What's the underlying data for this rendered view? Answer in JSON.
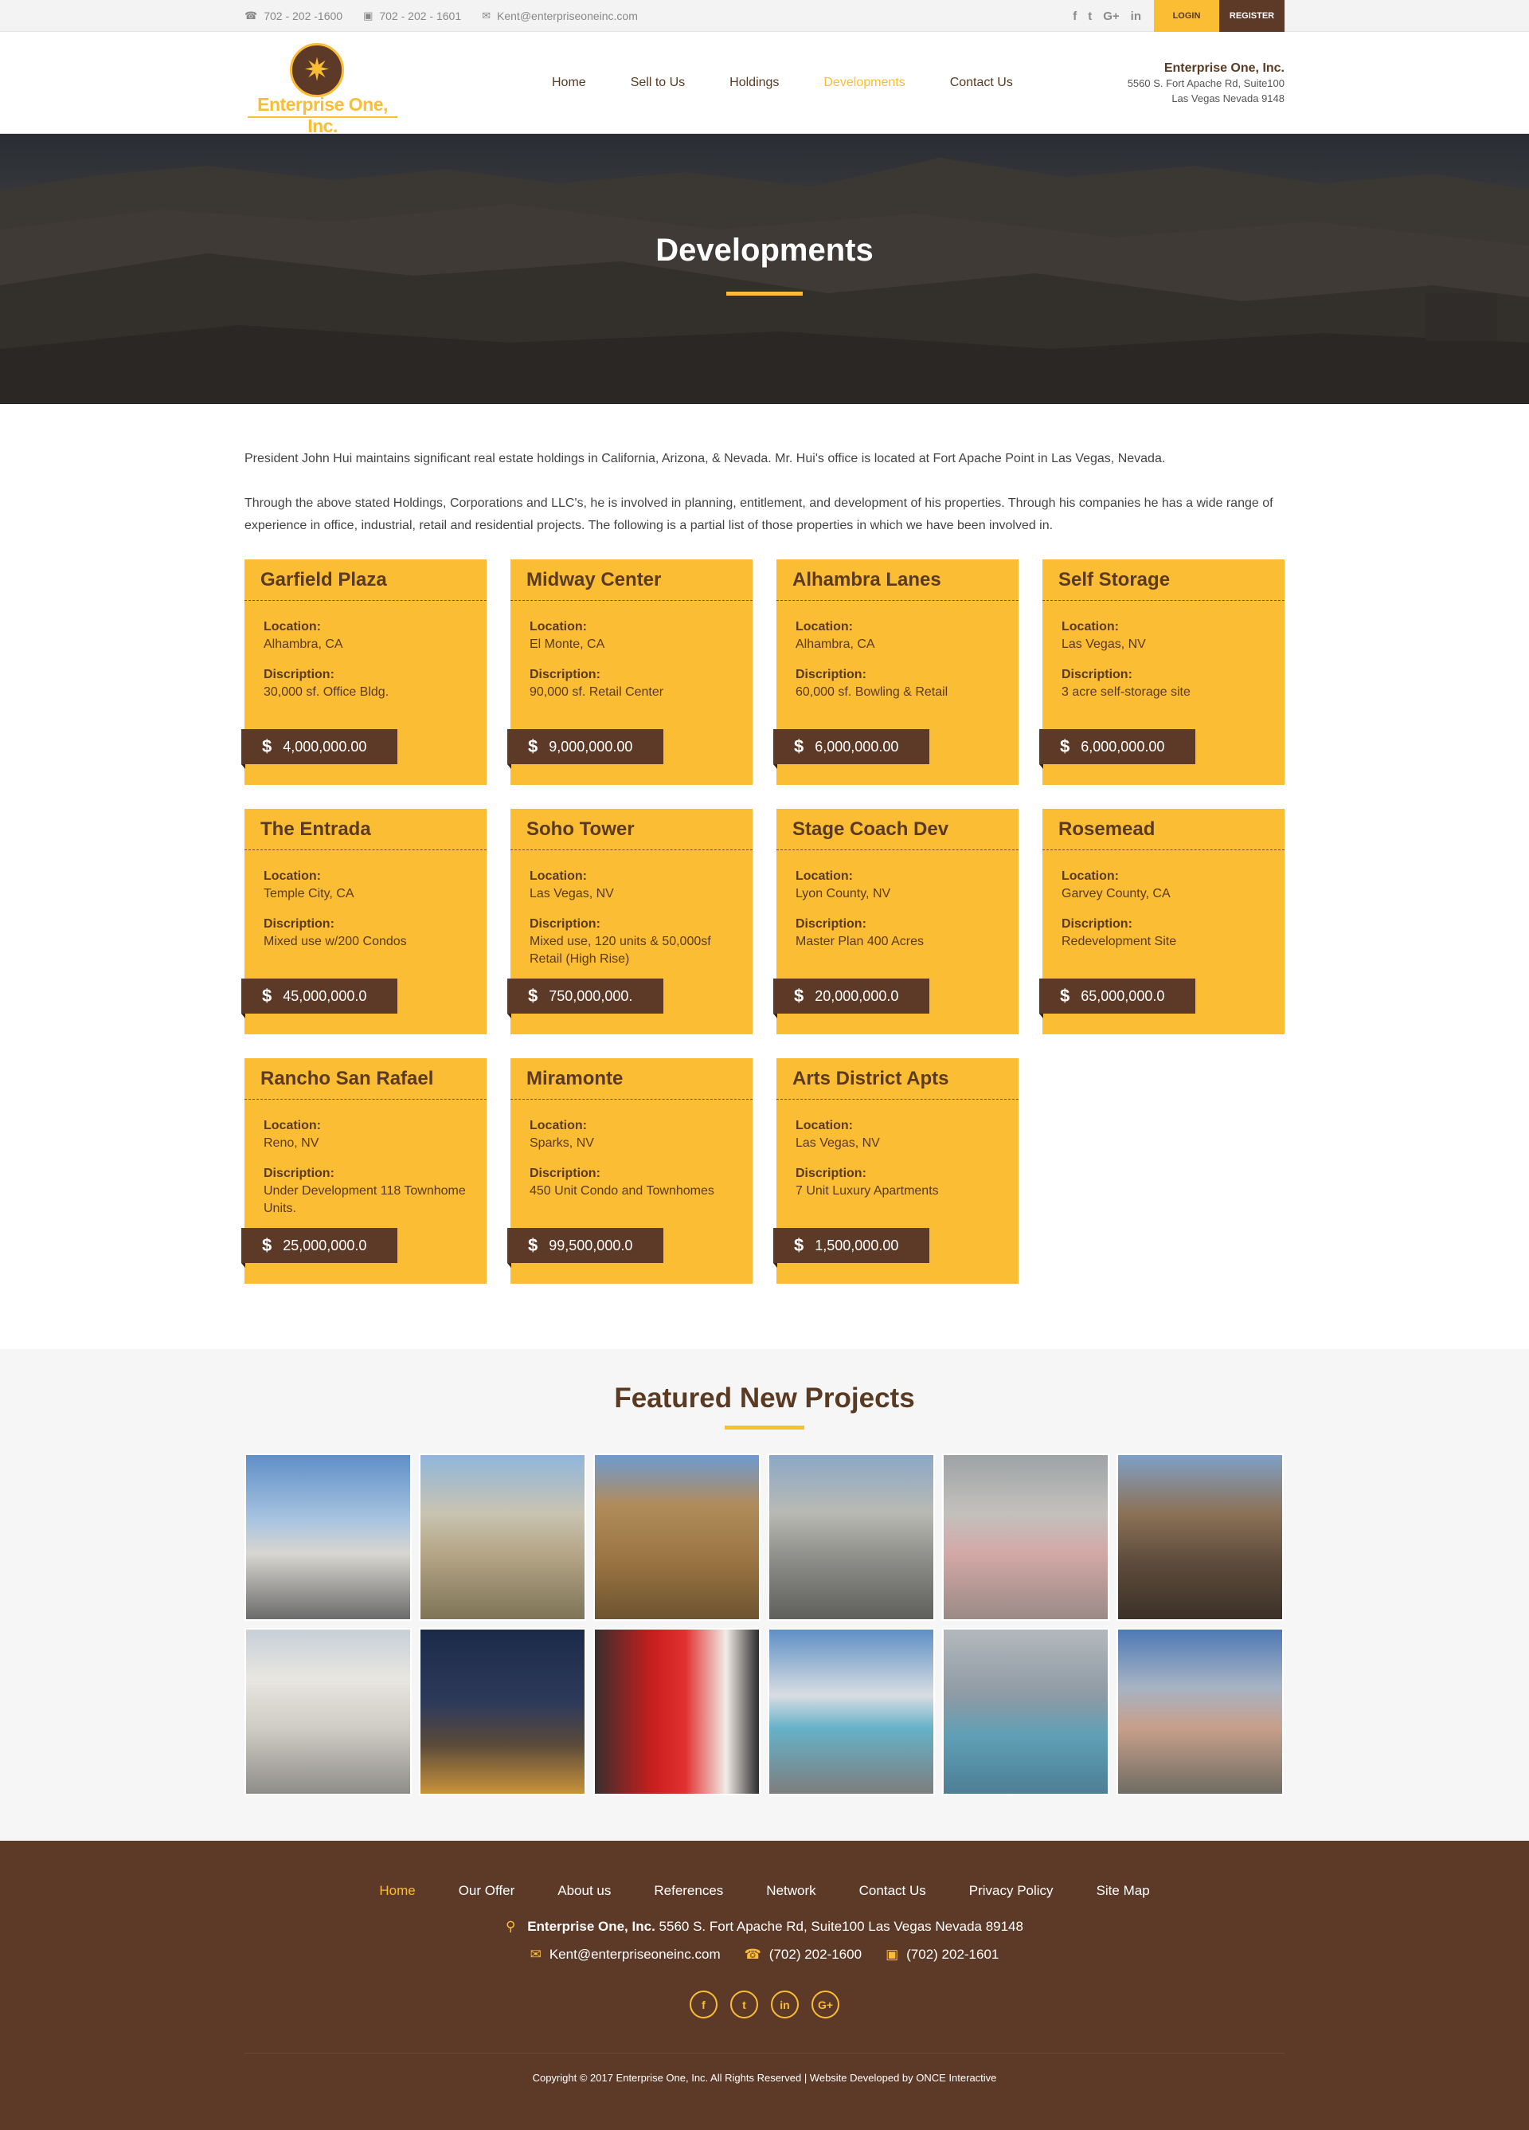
{
  "topbar": {
    "phone1": "702 - 202 -1600",
    "fax": "702 - 202 - 1601",
    "email": "Kent@enterpriseoneinc.com",
    "social": [
      "f",
      "t",
      "G+",
      "in"
    ],
    "login": "LOGIN",
    "register": "REGISTER"
  },
  "logo": {
    "text": "Enterprise One, Inc."
  },
  "nav": [
    "Home",
    "Sell to Us",
    "Holdings",
    "Developments",
    "Contact Us"
  ],
  "nav_active": "Developments",
  "company": {
    "name": "Enterprise One, Inc.",
    "address1": "5560 S. Fort Apache Rd, Suite100",
    "address2": "Las Vegas Nevada 9148"
  },
  "hero": {
    "title": "Developments"
  },
  "intro": {
    "p1": "President John Hui maintains significant real estate holdings in California, Arizona, & Nevada. Mr. Hui's office is located at Fort Apache Point in Las Vegas, Nevada.",
    "p2": "Through the above stated Holdings, Corporations and LLC's, he is involved in planning, entitlement, and development of his properties. Through his companies he has a wide range of experience in office, industrial, retail and residential projects. The following is a partial list of those properties in which we have been involved in."
  },
  "card_labels": {
    "location": "Location:",
    "description": "Discription:",
    "currency": "$"
  },
  "cards": [
    {
      "title": "Garfield Plaza",
      "location": "Alhambra, CA",
      "description": "30,000 sf. Office Bldg.",
      "price": "4,000,000.00"
    },
    {
      "title": "Midway Center",
      "location": "El Monte, CA",
      "description": "90,000 sf. Retail Center",
      "price": "9,000,000.00"
    },
    {
      "title": "Alhambra Lanes",
      "location": "Alhambra, CA",
      "description": "60,000 sf. Bowling & Retail",
      "price": "6,000,000.00"
    },
    {
      "title": "Self Storage",
      "location": "Las Vegas, NV",
      "description": "3 acre self-storage site",
      "price": "6,000,000.00"
    },
    {
      "title": "The Entrada",
      "location": "Temple City, CA",
      "description": "Mixed use w/200 Condos",
      "price": "45,000,000.0"
    },
    {
      "title": "Soho Tower",
      "location": "Las Vegas, NV",
      "description": "Mixed use, 120 units & 50,000sf Retail (High Rise)",
      "price": "750,000,000."
    },
    {
      "title": "Stage Coach Dev",
      "location": "Lyon County, NV",
      "description": "Master Plan 400 Acres",
      "price": "20,000,000.0"
    },
    {
      "title": "Rosemead",
      "location": "Garvey County, CA",
      "description": "Redevelopment Site",
      "price": "65,000,000.0"
    },
    {
      "title": "Rancho San Rafael",
      "location": "Reno, NV",
      "description": "Under Development 118 Townhome Units.",
      "price": "25,000,000.0"
    },
    {
      "title": "Miramonte",
      "location": "Sparks, NV",
      "description": "450 Unit Condo and Townhomes",
      "price": "99,500,000.0"
    },
    {
      "title": "Arts District Apts",
      "location": "Las Vegas, NV",
      "description": "7 Unit Luxury Apartments",
      "price": "1,500,000.00"
    }
  ],
  "featured": {
    "title": "Featured New Projects"
  },
  "footer": {
    "nav": [
      "Home",
      "Our Offer",
      "About us",
      "References",
      "Network",
      "Contact Us",
      "Privacy Policy",
      "Site Map"
    ],
    "nav_active": "Home",
    "company_name": "Enterprise One, Inc.",
    "address": "5560 S. Fort Apache Rd, Suite100 Las Vegas Nevada 89148",
    "email": "Kent@enterpriseoneinc.com",
    "phone": "(702) 202-1600",
    "fax": "(702) 202-1601",
    "social": [
      "f",
      "t",
      "in",
      "G+"
    ],
    "copyright": "Copyright © 2017 Enterprise One, Inc. All Rights Reserved | Website Developed by ONCE Interactive"
  },
  "colors": {
    "accent": "#fbbd34",
    "brown": "#5d3927"
  }
}
